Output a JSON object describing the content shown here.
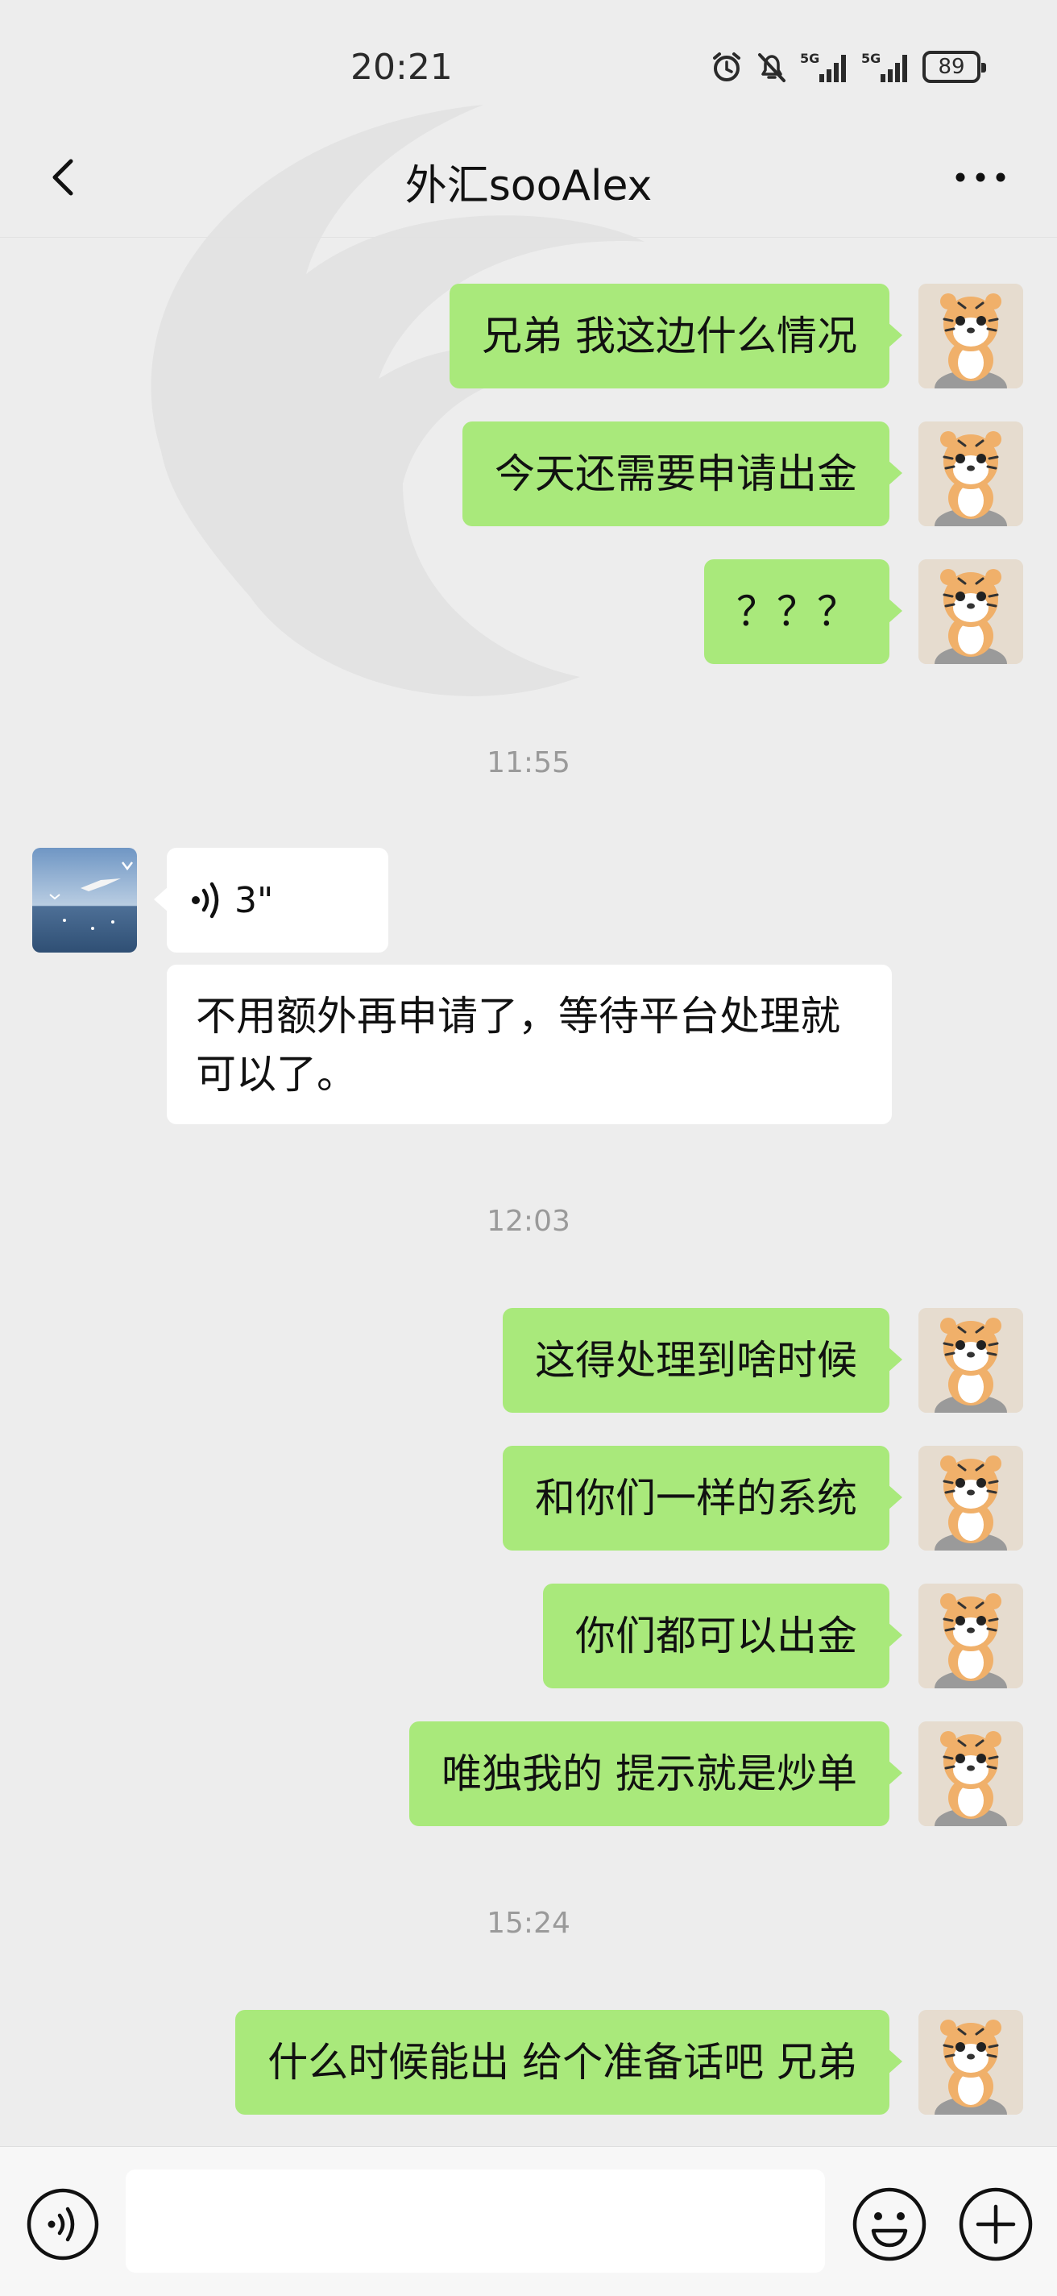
{
  "status_bar": {
    "time": "20:21",
    "battery": "89",
    "icons": [
      "alarm-icon",
      "mute-bell-icon",
      "signal-5g-icon",
      "signal-5g-icon",
      "battery-icon"
    ]
  },
  "nav": {
    "title": "外汇sooAlex",
    "back_icon": "chevron-left-icon",
    "more_icon": "more-dots-icon"
  },
  "messages": {
    "out1": "兄弟  我这边什么情况",
    "out2": "今天还需要申请出金",
    "out3": "？？？",
    "time1": "11:55",
    "voice_duration": "3\"",
    "in_text": "不用额外再申请了，等待平台处理就可以了。",
    "time2": "12:03",
    "out4": "这得处理到啥时候",
    "out5": "和你们一样的系统",
    "out6": "你们都可以出金",
    "out7": "唯独我的 提示就是炒单",
    "time3": "15:24",
    "out8": "什么时候能出 给个准备话吧  兄弟"
  },
  "input_bar": {
    "icons": [
      "voice-input-icon",
      "emoji-icon",
      "plus-icon"
    ],
    "text_value": ""
  },
  "colors": {
    "background": "#ededed",
    "outgoing_bubble": "#a9e97b",
    "incoming_bubble": "#ffffff",
    "timestamp": "#9a9a9a"
  }
}
